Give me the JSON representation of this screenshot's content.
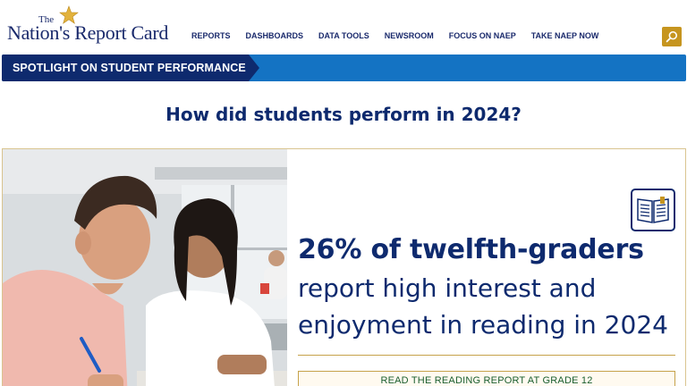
{
  "header": {
    "logo_the": "The",
    "logo_main": "Nation's Report Card",
    "nav": [
      "REPORTS",
      "DASHBOARDS",
      "DATA TOOLS",
      "NEWSROOM",
      "FOCUS ON NAEP",
      "TAKE NAEP NOW"
    ],
    "search_icon": "search-icon"
  },
  "spotlight": {
    "label": "SPOTLIGHT ON STUDENT PERFORMANCE"
  },
  "main": {
    "heading": "How did students perform in 2024?",
    "card": {
      "stat_bold": "26% of twelfth-graders",
      "stat_line2": "report high interest and",
      "stat_line3": "enjoyment in reading in 2024",
      "cta_label": "READ THE READING REPORT AT GRADE 12",
      "icon": "open-book-icon"
    }
  },
  "colors": {
    "navy": "#0e2a6e",
    "blue": "#1473c3",
    "gold": "#c6951f",
    "cta_text": "#1a5e2e"
  }
}
